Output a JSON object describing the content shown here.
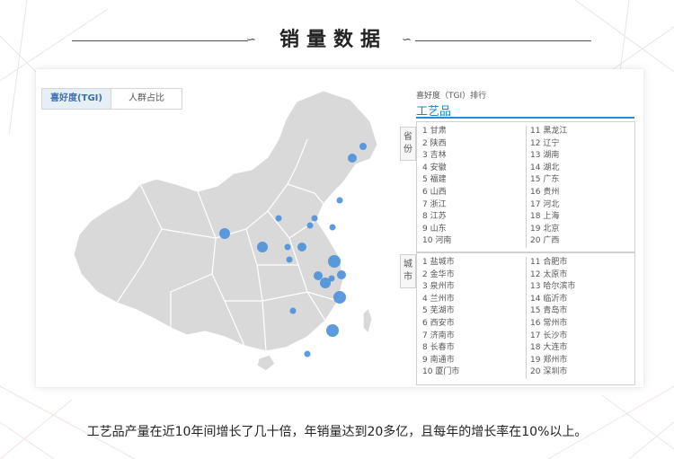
{
  "header": {
    "title": "销量数据",
    "knot_symbol": "∽"
  },
  "tabs": {
    "active": "喜好度(TGI)",
    "inactive": "人群占比"
  },
  "ranking": {
    "title": "喜好度（TGI）排行",
    "category": "工艺品",
    "province_label": "省份",
    "city_label": "城市",
    "provinces_col1": [
      "1  甘肃",
      "2  陕西",
      "3  吉林",
      "4  安徽",
      "5  福建",
      "6  山西",
      "7  浙江",
      "8  江苏",
      "9  山东",
      "10 河南"
    ],
    "provinces_col2": [
      "11 黑龙江",
      "12 辽宁",
      "13 湖南",
      "14 湖北",
      "15 广东",
      "16 贵州",
      "17 河北",
      "18 上海",
      "19 北京",
      "20 广西"
    ],
    "cities_col1": [
      "1  盐城市",
      "2  金华市",
      "3  泉州市",
      "4  兰州市",
      "5  芜湖市",
      "6  西安市",
      "7  济南市",
      "8  长春市",
      "9  南通市",
      "10 厦门市"
    ],
    "cities_col2": [
      "11 合肥市",
      "12 太原市",
      "13 哈尔滨市",
      "14 临沂市",
      "15 青岛市",
      "16 常州市",
      "17 长沙市",
      "18 大连市",
      "19 郑州市",
      "20 深圳市"
    ]
  },
  "map": {
    "marker_color": "#4a90d9",
    "land_color": "#d9d9d9",
    "border_color": "#ffffff"
  },
  "caption": "工艺品产量在近10年间增长了几十倍，年销量达到20多亿，且每年的增长率在10%以上。"
}
